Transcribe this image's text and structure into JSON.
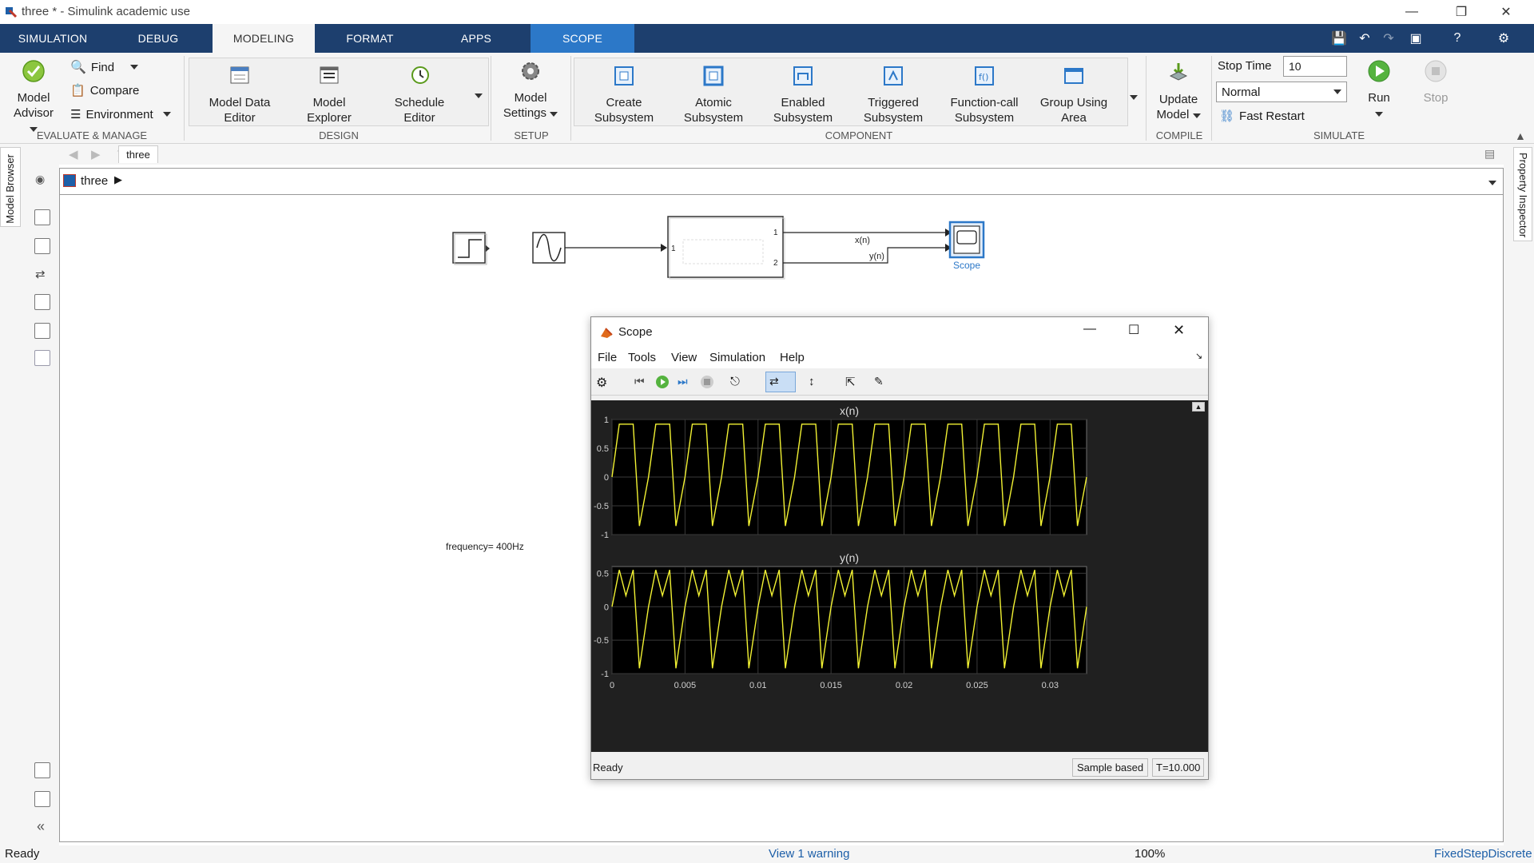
{
  "window": {
    "title": "three * - Simulink academic use"
  },
  "tabs": [
    {
      "label": "SIMULATION"
    },
    {
      "label": "DEBUG"
    },
    {
      "label": "MODELING"
    },
    {
      "label": "FORMAT"
    },
    {
      "label": "APPS"
    },
    {
      "label": "SCOPE"
    }
  ],
  "ribbon": {
    "evaluate": {
      "model_advisor": "Model\nAdvisor",
      "model_label": "Model",
      "advisor_label": "Advisor",
      "find": "Find",
      "compare": "Compare",
      "environment": "Environment",
      "section": "EVALUATE & MANAGE"
    },
    "design": {
      "mde1": "Model Data",
      "mde2": "Editor",
      "me1": "Model",
      "me2": "Explorer",
      "se1": "Schedule",
      "se2": "Editor",
      "section": "DESIGN"
    },
    "setup": {
      "ms1": "Model",
      "ms2": "Settings",
      "section": "SETUP"
    },
    "component": {
      "items": [
        {
          "l1": "Create",
          "l2": "Subsystem"
        },
        {
          "l1": "Atomic",
          "l2": "Subsystem"
        },
        {
          "l1": "Enabled",
          "l2": "Subsystem"
        },
        {
          "l1": "Triggered",
          "l2": "Subsystem"
        },
        {
          "l1": "Function-call",
          "l2": "Subsystem"
        },
        {
          "l1": "Group Using",
          "l2": "Area"
        }
      ],
      "section": "COMPONENT"
    },
    "compile": {
      "um1": "Update",
      "um2": "Model",
      "section": "COMPILE"
    },
    "simulate": {
      "stop_time_label": "Stop Time",
      "stop_time_value": "10",
      "mode": "Normal",
      "fast_restart": "Fast Restart",
      "run": "Run",
      "stop": "Stop",
      "section": "SIMULATE"
    }
  },
  "left_panel": {
    "model_browser": "Model Browser"
  },
  "right_panel": {
    "property_inspector": "Property Inspector"
  },
  "breadcrumb": {
    "tab": "three",
    "path": "three"
  },
  "diagram": {
    "signal_x": "x(n)",
    "signal_y": "y(n)",
    "scope_label": "Scope",
    "annotation": "frequency= 400Hz",
    "sub_port_in": "1",
    "sub_port_out1": "1",
    "sub_port_out2": "2",
    "sine_port_in": "1"
  },
  "scope": {
    "title": "Scope",
    "menu": [
      "File",
      "Tools",
      "View",
      "Simulation",
      "Help"
    ],
    "status_left": "Ready",
    "status_mode": "Sample based",
    "status_time": "T=10.000"
  },
  "chart_data": [
    {
      "type": "line",
      "title": "x(n)",
      "ylim": [
        -1,
        1
      ],
      "yticks": [
        "1",
        "0.5",
        "0",
        "-0.5",
        "-1"
      ],
      "xlim": [
        0,
        0.0325
      ],
      "color": "#f2f233",
      "background": "#000000",
      "grid": true,
      "series": [
        {
          "period": 0.0025,
          "peaks": [
            0.92,
            -0.85
          ]
        }
      ]
    },
    {
      "type": "line",
      "title": "y(n)",
      "ylim": [
        -1,
        0.6
      ],
      "yticks": [
        "0.5",
        "0",
        "-0.5",
        "-1"
      ],
      "xticks": [
        "0",
        "0.005",
        "0.01",
        "0.015",
        "0.02",
        "0.025",
        "0.03"
      ],
      "xlim": [
        0,
        0.0325
      ],
      "color": "#f2f233",
      "background": "#000000",
      "grid": true,
      "series": [
        {
          "period": 0.0025,
          "peaks": [
            0.55,
            -0.92
          ]
        }
      ]
    }
  ],
  "status": {
    "left": "Ready",
    "center": "View 1 warning",
    "zoom": "100%",
    "solver": "FixedStepDiscrete"
  },
  "colors": {
    "tabbar": "#1d3f6e",
    "scope_tab": "#2c78c8",
    "trace": "#f2f233"
  }
}
